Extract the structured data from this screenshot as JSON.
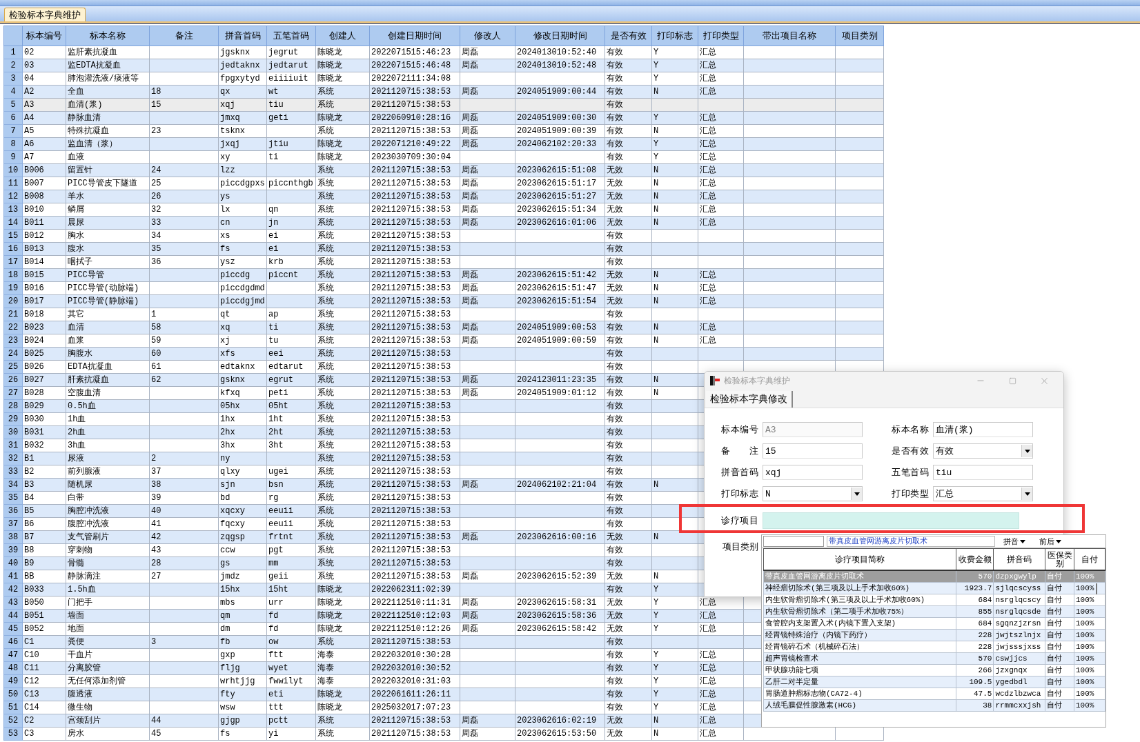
{
  "tab": {
    "label": "检验标本字典维护"
  },
  "table": {
    "columns": [
      "标本编号",
      "标本名称",
      "备注",
      "拼音首码",
      "五笔首码",
      "创建人",
      "创建日期时间",
      "修改人",
      "修改日期时间",
      "是否有效",
      "打印标志",
      "打印类型",
      "带出项目名称",
      "项目类别"
    ],
    "rows": [
      {
        "no": "1",
        "selected": false,
        "code": "02",
        "name": "监肝素抗凝血",
        "py": "jgsknx",
        "wb": "jegrut",
        "creator": "陈晓龙",
        "created": "2022071515:46:23",
        "modifier": "周磊",
        "modified": "2024013010:52:40",
        "valid": "有效",
        "flag": "Y",
        "type": "汇总"
      },
      {
        "no": "2",
        "selected": false,
        "code": "03",
        "name": "监EDTA抗凝血",
        "py": "jedtaknx",
        "wb": "jedtarut",
        "creator": "陈晓龙",
        "created": "2022071515:46:48",
        "modifier": "周磊",
        "modified": "2024013010:52:48",
        "valid": "有效",
        "flag": "Y",
        "type": "汇总"
      },
      {
        "no": "3",
        "selected": false,
        "code": "04",
        "name": "肺泡灌洗液/痰液等",
        "py": "fpgxytyd",
        "wb": "eiiiiuit",
        "creator": "陈晓龙",
        "created": "2022072111:34:08",
        "valid": "有效",
        "flag": "Y",
        "type": "汇总"
      },
      {
        "no": "4",
        "selected": false,
        "code": "A2",
        "name": "全血",
        "note": "18",
        "py": "qx",
        "wb": "wt",
        "creator": "系统",
        "created": "2021120715:38:53",
        "modifier": "周磊",
        "modified": "2024051909:00:44",
        "valid": "有效",
        "flag": "N",
        "type": "汇总"
      },
      {
        "no": "5",
        "selected": true,
        "code": "A3",
        "name": "血清(浆)",
        "note": "15",
        "py": "xqj",
        "wb": "tiu",
        "creator": "系统",
        "created": "2021120715:38:53",
        "valid": "有效"
      },
      {
        "no": "6",
        "selected": false,
        "code": "A4",
        "name": "静脉血清",
        "py": "jmxq",
        "wb": "geti",
        "creator": "陈晓龙",
        "created": "2022060910:28:16",
        "modifier": "周磊",
        "modified": "2024051909:00:30",
        "valid": "有效",
        "flag": "Y",
        "type": "汇总"
      },
      {
        "no": "7",
        "selected": false,
        "code": "A5",
        "name": "特殊抗凝血",
        "note": "23",
        "py": "tsknx",
        "creator": "系统",
        "created": "2021120715:38:53",
        "modifier": "周磊",
        "modified": "2024051909:00:39",
        "valid": "有效",
        "flag": "N",
        "type": "汇总"
      },
      {
        "no": "8",
        "selected": false,
        "code": "A6",
        "name": "监血清（浆）",
        "py": "jxqj",
        "wb": "jtiu",
        "creator": "陈晓龙",
        "created": "2022071210:49:22",
        "modifier": "周磊",
        "modified": "2024062102:20:33",
        "valid": "有效",
        "flag": "Y",
        "type": "汇总"
      },
      {
        "no": "9",
        "selected": false,
        "code": "A7",
        "name": "血液",
        "py": "xy",
        "wb": "ti",
        "creator": "陈晓龙",
        "created": "2023030709:30:04",
        "valid": "有效",
        "flag": "Y",
        "type": "汇总"
      },
      {
        "no": "10",
        "selected": false,
        "code": "B006",
        "name": "留置针",
        "note": "24",
        "py": "lzz",
        "creator": "系统",
        "created": "2021120715:38:53",
        "modifier": "周磊",
        "modified": "2023062615:51:08",
        "valid": "无效",
        "flag": "N",
        "type": "汇总"
      },
      {
        "no": "11",
        "selected": false,
        "code": "B007",
        "name": "PICC导管皮下隧道",
        "note": "25",
        "py": "piccdgpxs",
        "wb": "piccnthgb",
        "creator": "系统",
        "created": "2021120715:38:53",
        "modifier": "周磊",
        "modified": "2023062615:51:17",
        "valid": "无效",
        "flag": "N",
        "type": "汇总"
      },
      {
        "no": "12",
        "selected": false,
        "code": "B008",
        "name": "羊水",
        "note": "26",
        "py": "ys",
        "creator": "系统",
        "created": "2021120715:38:53",
        "modifier": "周磊",
        "modified": "2023062615:51:27",
        "valid": "无效",
        "flag": "N",
        "type": "汇总"
      },
      {
        "no": "13",
        "selected": false,
        "code": "B010",
        "name": "鳞屑",
        "note": "32",
        "py": "lx",
        "wb": "qn",
        "creator": "系统",
        "created": "2021120715:38:53",
        "modifier": "周磊",
        "modified": "2023062615:51:34",
        "valid": "无效",
        "flag": "N",
        "type": "汇总"
      },
      {
        "no": "14",
        "selected": false,
        "code": "B011",
        "name": "晨尿",
        "note": "33",
        "py": "cn",
        "wb": "jn",
        "creator": "系统",
        "created": "2021120715:38:53",
        "modifier": "周磊",
        "modified": "2023062616:01:06",
        "valid": "无效",
        "flag": "N",
        "type": "汇总"
      },
      {
        "no": "15",
        "selected": false,
        "code": "B012",
        "name": "胸水",
        "note": "34",
        "py": "xs",
        "wb": "ei",
        "creator": "系统",
        "created": "2021120715:38:53",
        "valid": "有效"
      },
      {
        "no": "16",
        "selected": false,
        "code": "B013",
        "name": "腹水",
        "note": "35",
        "py": "fs",
        "wb": "ei",
        "creator": "系统",
        "created": "2021120715:38:53",
        "valid": "有效"
      },
      {
        "no": "17",
        "selected": false,
        "code": "B014",
        "name": "咽拭子",
        "note": "36",
        "py": "ysz",
        "wb": "krb",
        "creator": "系统",
        "created": "2021120715:38:53",
        "valid": "有效"
      },
      {
        "no": "18",
        "selected": false,
        "code": "B015",
        "name": "PICC导管",
        "py": "piccdg",
        "wb": "piccnt",
        "creator": "系统",
        "created": "2021120715:38:53",
        "modifier": "周磊",
        "modified": "2023062615:51:42",
        "valid": "无效",
        "flag": "N",
        "type": "汇总"
      },
      {
        "no": "19",
        "selected": false,
        "code": "B016",
        "name": "PICC导管(动脉端)",
        "py": "piccdgdmd",
        "creator": "系统",
        "created": "2021120715:38:53",
        "modifier": "周磊",
        "modified": "2023062615:51:47",
        "valid": "无效",
        "flag": "N",
        "type": "汇总"
      },
      {
        "no": "20",
        "selected": false,
        "code": "B017",
        "name": "PICC导管(静脉端)",
        "py": "piccdgjmd",
        "creator": "系统",
        "created": "2021120715:38:53",
        "modifier": "周磊",
        "modified": "2023062615:51:54",
        "valid": "无效",
        "flag": "N",
        "type": "汇总"
      },
      {
        "no": "21",
        "selected": false,
        "code": "B018",
        "name": "其它",
        "note": "1",
        "py": "qt",
        "wb": "ap",
        "creator": "系统",
        "created": "2021120715:38:53",
        "valid": "有效"
      },
      {
        "no": "22",
        "selected": false,
        "code": "B023",
        "name": "血清",
        "note": "58",
        "py": "xq",
        "wb": "ti",
        "creator": "系统",
        "created": "2021120715:38:53",
        "modifier": "周磊",
        "modified": "2024051909:00:53",
        "valid": "有效",
        "flag": "N",
        "type": "汇总"
      },
      {
        "no": "23",
        "selected": false,
        "code": "B024",
        "name": "血浆",
        "note": "59",
        "py": "xj",
        "wb": "tu",
        "creator": "系统",
        "created": "2021120715:38:53",
        "modifier": "周磊",
        "modified": "2024051909:00:59",
        "valid": "有效",
        "flag": "N",
        "type": "汇总"
      },
      {
        "no": "24",
        "selected": false,
        "code": "B025",
        "name": "胸腹水",
        "note": "60",
        "py": "xfs",
        "wb": "eei",
        "creator": "系统",
        "created": "2021120715:38:53",
        "valid": "有效"
      },
      {
        "no": "25",
        "selected": false,
        "code": "B026",
        "name": "EDTA抗凝血",
        "note": "61",
        "py": "edtaknx",
        "wb": "edtarut",
        "creator": "系统",
        "created": "2021120715:38:53",
        "valid": "有效"
      },
      {
        "no": "26",
        "selected": false,
        "code": "B027",
        "name": "肝素抗凝血",
        "note": "62",
        "py": "gsknx",
        "wb": "egrut",
        "creator": "系统",
        "created": "2021120715:38:53",
        "modifier": "周磊",
        "modified": "2024123011:23:35",
        "valid": "有效",
        "flag": "N"
      },
      {
        "no": "27",
        "selected": false,
        "code": "B028",
        "name": "空腹血清",
        "py": "kfxq",
        "wb": "peti",
        "creator": "系统",
        "created": "2021120715:38:53",
        "modifier": "周磊",
        "modified": "2024051909:01:12",
        "valid": "有效",
        "flag": "N"
      },
      {
        "no": "28",
        "selected": false,
        "code": "B029",
        "name": "0.5h血",
        "py": "05hx",
        "wb": "05ht",
        "creator": "系统",
        "created": "2021120715:38:53",
        "valid": "有效"
      },
      {
        "no": "29",
        "selected": false,
        "code": "B030",
        "name": "1h血",
        "py": "1hx",
        "wb": "1ht",
        "creator": "系统",
        "created": "2021120715:38:53",
        "valid": "有效"
      },
      {
        "no": "30",
        "selected": false,
        "code": "B031",
        "name": "2h血",
        "py": "2hx",
        "wb": "2ht",
        "creator": "系统",
        "created": "2021120715:38:53",
        "valid": "有效"
      },
      {
        "no": "31",
        "selected": false,
        "code": "B032",
        "name": "3h血",
        "py": "3hx",
        "wb": "3ht",
        "creator": "系统",
        "created": "2021120715:38:53",
        "valid": "有效"
      },
      {
        "no": "32",
        "selected": false,
        "code": "B1",
        "name": "尿液",
        "note": "2",
        "py": "ny",
        "creator": "系统",
        "created": "2021120715:38:53",
        "valid": "有效"
      },
      {
        "no": "33",
        "selected": false,
        "code": "B2",
        "name": "前列腺液",
        "note": "37",
        "py": "qlxy",
        "wb": "ugei",
        "creator": "系统",
        "created": "2021120715:38:53",
        "valid": "有效"
      },
      {
        "no": "34",
        "selected": false,
        "code": "B3",
        "name": "随机尿",
        "note": "38",
        "py": "sjn",
        "wb": "bsn",
        "creator": "系统",
        "created": "2021120715:38:53",
        "modifier": "周磊",
        "modified": "2024062102:21:04",
        "valid": "有效",
        "flag": "N"
      },
      {
        "no": "35",
        "selected": false,
        "code": "B4",
        "name": "白带",
        "note": "39",
        "py": "bd",
        "wb": "rg",
        "creator": "系统",
        "created": "2021120715:38:53",
        "valid": "有效"
      },
      {
        "no": "36",
        "selected": false,
        "code": "B5",
        "name": "胸腔冲洗液",
        "note": "40",
        "py": "xqcxy",
        "wb": "eeuii",
        "creator": "系统",
        "created": "2021120715:38:53",
        "valid": "有效"
      },
      {
        "no": "37",
        "selected": false,
        "code": "B6",
        "name": "腹腔冲洗液",
        "note": "41",
        "py": "fqcxy",
        "wb": "eeuii",
        "creator": "系统",
        "created": "2021120715:38:53",
        "valid": "有效"
      },
      {
        "no": "38",
        "selected": false,
        "code": "B7",
        "name": "支气管刷片",
        "note": "42",
        "py": "zqgsp",
        "wb": "frtnt",
        "creator": "系统",
        "created": "2021120715:38:53",
        "modifier": "周磊",
        "modified": "2023062616:00:16",
        "valid": "无效",
        "flag": "N"
      },
      {
        "no": "39",
        "selected": false,
        "code": "B8",
        "name": "穿刺物",
        "note": "43",
        "py": "ccw",
        "wb": "pgt",
        "creator": "系统",
        "created": "2021120715:38:53",
        "valid": "有效"
      },
      {
        "no": "40",
        "selected": false,
        "code": "B9",
        "name": "骨髓",
        "note": "28",
        "py": "gs",
        "wb": "mm",
        "creator": "系统",
        "created": "2021120715:38:53",
        "valid": "有效"
      },
      {
        "no": "41",
        "selected": false,
        "code": "BB",
        "name": "静脉滴注",
        "note": "27",
        "py": "jmdz",
        "wb": "geii",
        "creator": "系统",
        "created": "2021120715:38:53",
        "modifier": "周磊",
        "modified": "2023062615:52:39",
        "valid": "无效",
        "flag": "N"
      },
      {
        "no": "42",
        "selected": false,
        "code": "B033",
        "name": "1.5h血",
        "py": "15hx",
        "wb": "15ht",
        "creator": "陈晓龙",
        "created": "2022062311:02:39",
        "valid": "有效",
        "flag": "Y"
      },
      {
        "no": "43",
        "selected": false,
        "code": "B050",
        "name": "门把手",
        "py": "mbs",
        "wb": "urr",
        "creator": "陈晓龙",
        "created": "2022112510:11:31",
        "modifier": "周磊",
        "modified": "2023062615:58:31",
        "valid": "无效",
        "flag": "Y",
        "type": "汇总"
      },
      {
        "no": "44",
        "selected": false,
        "code": "B051",
        "name": "墙面",
        "py": "qm",
        "wb": "fd",
        "creator": "陈晓龙",
        "created": "2022112510:12:03",
        "modifier": "周磊",
        "modified": "2023062615:58:36",
        "valid": "无效",
        "flag": "Y",
        "type": "汇总"
      },
      {
        "no": "45",
        "selected": false,
        "code": "B052",
        "name": "地面",
        "py": "dm",
        "wb": "fd",
        "creator": "陈晓龙",
        "created": "2022112510:12:26",
        "modifier": "周磊",
        "modified": "2023062615:58:42",
        "valid": "无效",
        "flag": "Y",
        "type": "汇总"
      },
      {
        "no": "46",
        "selected": false,
        "code": "C1",
        "name": "粪便",
        "note": "3",
        "py": "fb",
        "wb": "ow",
        "creator": "系统",
        "created": "2021120715:38:53",
        "valid": "有效"
      },
      {
        "no": "47",
        "selected": false,
        "code": "C10",
        "name": "干血片",
        "py": "gxp",
        "wb": "ftt",
        "creator": "海泰",
        "created": "2022032010:30:28",
        "valid": "有效",
        "flag": "Y",
        "type": "汇总"
      },
      {
        "no": "48",
        "selected": false,
        "code": "C11",
        "name": "分离胶管",
        "py": "fljg",
        "wb": "wyet",
        "creator": "海泰",
        "created": "2022032010:30:52",
        "valid": "有效",
        "flag": "Y",
        "type": "汇总"
      },
      {
        "no": "49",
        "selected": false,
        "code": "C12",
        "name": "无任何添加剂管",
        "py": "wrhtjjg",
        "wb": "fwwilyt",
        "creator": "海泰",
        "created": "2022032010:31:03",
        "valid": "有效",
        "flag": "Y",
        "type": "汇总"
      },
      {
        "no": "50",
        "selected": false,
        "code": "C13",
        "name": "腹透液",
        "py": "fty",
        "wb": "eti",
        "creator": "陈晓龙",
        "created": "2022061611:26:11",
        "valid": "有效",
        "flag": "Y",
        "type": "汇总"
      },
      {
        "no": "51",
        "selected": false,
        "code": "C14",
        "name": "微生物",
        "py": "wsw",
        "wb": "ttt",
        "creator": "陈晓龙",
        "created": "2025032017:07:23",
        "valid": "有效",
        "flag": "Y",
        "type": "汇总"
      },
      {
        "no": "52",
        "selected": false,
        "code": "C2",
        "name": "宫颈刮片",
        "note": "44",
        "py": "gjgp",
        "wb": "pctt",
        "creator": "系统",
        "created": "2021120715:38:53",
        "modifier": "周磊",
        "modified": "2023062616:02:19",
        "valid": "无效",
        "flag": "N",
        "type": "汇总"
      },
      {
        "no": "53",
        "selected": false,
        "code": "C3",
        "name": "房水",
        "note": "45",
        "py": "fs",
        "wb": "yi",
        "creator": "系统",
        "created": "2021120715:38:53",
        "modifier": "周磊",
        "modified": "2023062615:53:50",
        "valid": "无效",
        "flag": "N",
        "type": "汇总"
      }
    ]
  },
  "dialog": {
    "title": "检验标本字典维护",
    "tab": {
      "label": "检验标本字典修改"
    },
    "fields": [
      {
        "label": "标本编号",
        "value": "A3",
        "kind": "text",
        "disabled": true
      },
      {
        "label": "标本名称",
        "value": "血清(浆)",
        "kind": "text",
        "disabled": false
      },
      {
        "label": "备 注",
        "value": "15",
        "kind": "text",
        "disabled": false
      },
      {
        "label": "是否有效",
        "value": "有效",
        "kind": "select",
        "disabled": false
      },
      {
        "label": "拼音首码",
        "value": "xqj",
        "kind": "text",
        "disabled": false
      },
      {
        "label": "五笔首码",
        "value": "tiu",
        "kind": "text",
        "disabled": false
      },
      {
        "label": "打印标志",
        "value": "N",
        "kind": "select",
        "disabled": false
      },
      {
        "label": "打印类型",
        "value": "汇总",
        "kind": "select",
        "disabled": false
      }
    ],
    "diagnosis": {
      "label": "诊疗项目"
    },
    "category": {
      "label": "项目类别"
    }
  },
  "popup": {
    "search_text": "带真皮血管网游离皮片切取术",
    "options": [
      "拼音",
      "前后"
    ],
    "columns": [
      "诊疗项目简称",
      "收费金额",
      "拼音码",
      "医保类别",
      "自付"
    ],
    "rows": [
      {
        "selected": true,
        "cells": [
          "带真皮血管网游离皮片切取术",
          "570",
          "dzpxgwylp",
          "自付",
          "100%"
        ]
      },
      {
        "selected": false,
        "cells": [
          "神经瘤切除术(第三项及以上手术加收60%)",
          "1923.7",
          "sjlqcscyss",
          "自付",
          "100%"
        ]
      },
      {
        "selected": false,
        "cells": [
          "内生软骨瘤切除术(第三项及以上手术加收60%)",
          "684",
          "nsrglqcscy",
          "自付",
          "100%"
        ]
      },
      {
        "selected": false,
        "cells": [
          "内生软骨瘤切除术（第二项手术加收75%）",
          "855",
          "nsrglqcsde",
          "自付",
          "100%"
        ]
      },
      {
        "selected": false,
        "cells": [
          "食管腔内支架置入术(内镜下置入支架)",
          "684",
          "sgqnzjzrsn",
          "自付",
          "100%"
        ]
      },
      {
        "selected": false,
        "cells": [
          "经胃镜特殊治疗（内镜下药疗）",
          "228",
          "jwjtszlnjx",
          "自付",
          "100%"
        ]
      },
      {
        "selected": false,
        "cells": [
          "经胃镜碎石术（机械碎石法）",
          "228",
          "jwjsssjxss",
          "自付",
          "100%"
        ]
      },
      {
        "selected": false,
        "cells": [
          "超声胃镜检查术",
          "570",
          "cswjjcs",
          "自付",
          "100%"
        ]
      },
      {
        "selected": false,
        "cells": [
          "甲状腺功能七项",
          "266",
          "jzxgnqx",
          "自付",
          "100%"
        ]
      },
      {
        "selected": false,
        "cells": [
          "乙肝二对半定量",
          "109.5",
          "ygedbdl",
          "自付",
          "100%"
        ]
      },
      {
        "selected": false,
        "cells": [
          "胃肠道肿瘤标志物(CA72-4)",
          "47.5",
          "wcdzlbzwca",
          "自付",
          "100%"
        ]
      },
      {
        "selected": false,
        "cells": [
          "人绒毛膜促性腺激素(HCG)",
          "38",
          "rrmmcxxjsh",
          "自付",
          "100%"
        ]
      }
    ]
  }
}
